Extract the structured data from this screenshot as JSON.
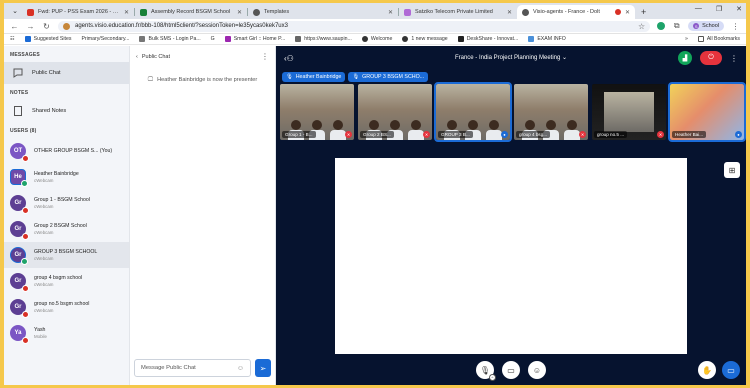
{
  "browser": {
    "tabs": [
      {
        "title": "Fwd: PUP - PSS Exam 2026 - sud",
        "color": "#d93025",
        "active": false
      },
      {
        "title": "Assembly Record BSGM School",
        "color": "#188038",
        "active": false
      },
      {
        "title": "Templates",
        "color": "#555555",
        "active": false
      },
      {
        "title": "Satziko Telecom Private Limited",
        "color": "#b06ad6",
        "active": false
      },
      {
        "title": "Visio-agents - France - Dolt",
        "color": "#555555",
        "active": true
      }
    ],
    "url": "agents.visio.education.fr/bbb-108/html5client/?sessionToken=le35ycas0kek7ux3",
    "profile_label": "School",
    "bookmarks": [
      {
        "label": "Suggested Sites",
        "color": "#1b6bd6"
      },
      {
        "label": "Primary/Secondary...",
        "color": "#f4b400"
      },
      {
        "label": "Bulk SMS - Login Pa...",
        "color": "#777777"
      },
      {
        "label": "G",
        "color": "#4285f4"
      },
      {
        "label": "Smart Girl :: Home P...",
        "color": "#9c27b0"
      },
      {
        "label": "https://www.saupin...",
        "color": "#666666"
      },
      {
        "label": "Welcome",
        "color": "#333333"
      },
      {
        "label": "1 new message",
        "color": "#333333"
      },
      {
        "label": "DeskShare - Innovat...",
        "color": "#222222"
      },
      {
        "label": "EXAM INFO",
        "color": "#4a90d9"
      }
    ],
    "bookmarks_overflow": "»",
    "all_bookmarks": "All Bookmarks"
  },
  "sidebar": {
    "messages_title": "MESSAGES",
    "public_chat": "Public Chat",
    "notes_title": "NOTES",
    "shared_notes": "Shared Notes",
    "users_title": "USERS (8)",
    "users": [
      {
        "initials": "OT",
        "name": "OTHER GROUP BSGM S...  (You)",
        "sub": "",
        "color": "#7b56c4",
        "dot": "#1b6bd6"
      },
      {
        "initials": "He",
        "name": "Heather Bainbridge",
        "sub": "cWebcam",
        "color": "#6f4aa8",
        "dot": "#1ea36a"
      },
      {
        "initials": "Gr",
        "name": "Group 1 - BSGM School",
        "sub": "cWebcam",
        "color": "#5d3f93",
        "dot": "#d93025"
      },
      {
        "initials": "Gr",
        "name": "Group 2 BSGM School",
        "sub": "cWebcam",
        "color": "#5d3f93",
        "dot": "#d93025"
      },
      {
        "initials": "Gr",
        "name": "GROUP 3 BSGM SCHOOL",
        "sub": "cWebcam",
        "color": "#5d3f93",
        "dot": "#1ea36a"
      },
      {
        "initials": "Gr",
        "name": "group 4 bsgm school",
        "sub": "cWebcam",
        "color": "#5d3f93",
        "dot": "#d93025"
      },
      {
        "initials": "Gr",
        "name": "group no.5 bsgm school",
        "sub": "cWebcam",
        "color": "#5d3f93",
        "dot": "#d93025"
      },
      {
        "initials": "Ya",
        "name": "Yash",
        "sub": "Mobile",
        "color": "#7b56c4",
        "dot": "#d93025"
      }
    ]
  },
  "chat": {
    "title": "Public Chat",
    "system_message": "Heather Bainbridge is now the presenter",
    "placeholder": "Message Public Chat"
  },
  "meeting": {
    "title": "France - India Project Planning Meeting",
    "presenter_pill": "Heather Bainbridge",
    "group_pill": "GROUP 3 BSGM SCHO...",
    "tiles": [
      {
        "caption": "Group 1 - B...",
        "mic": "off"
      },
      {
        "caption": "Group 2 BS...",
        "mic": "off"
      },
      {
        "caption": "GROUP 3 B...",
        "mic": "on"
      },
      {
        "caption": "group 4 bsg...",
        "mic": "off"
      },
      {
        "caption": "group no.5 ...",
        "mic": "off"
      },
      {
        "caption": "Heather Bai...",
        "mic": "on"
      }
    ]
  }
}
